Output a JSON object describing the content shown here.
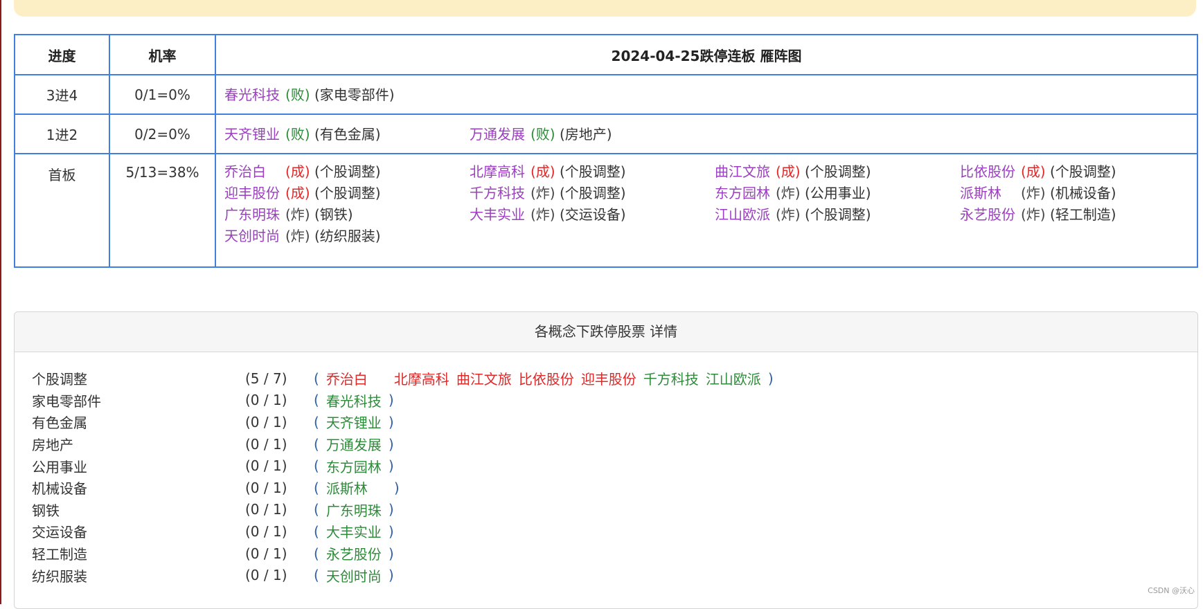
{
  "header": {
    "stage_label": "进度",
    "rate_label": "机率",
    "title": "2024-04-25跌停连板 雁阵图"
  },
  "rows": [
    {
      "stage": "3进4",
      "rate": "0/1=0%",
      "stocks": [
        {
          "name": "春光科技",
          "result": "(败)",
          "result_type": "fail",
          "industry": "(家电零部件)"
        }
      ]
    },
    {
      "stage": "1进2",
      "rate": "0/2=0%",
      "stocks": [
        {
          "name": "天齐锂业",
          "result": "(败)",
          "result_type": "fail",
          "industry": "(有色金属)"
        },
        {
          "name": "万通发展",
          "result": "(败)",
          "result_type": "fail",
          "industry": "(房地产)"
        }
      ]
    },
    {
      "stage": "首板",
      "rate": "5/13=38%",
      "stocks": [
        {
          "name": "乔治白",
          "result": "(成)",
          "result_type": "ok",
          "industry": "(个股调整)"
        },
        {
          "name": "北摩高科",
          "result": "(成)",
          "result_type": "ok",
          "industry": "(个股调整)"
        },
        {
          "name": "曲江文旅",
          "result": "(成)",
          "result_type": "ok",
          "industry": "(个股调整)"
        },
        {
          "name": "比依股份",
          "result": "(成)",
          "result_type": "ok",
          "industry": "(个股调整)"
        },
        {
          "name": "迎丰股份",
          "result": "(成)",
          "result_type": "ok",
          "industry": "(个股调整)"
        },
        {
          "name": "千方科技",
          "result": "(炸)",
          "result_type": "boom",
          "industry": "(个股调整)"
        },
        {
          "name": "东方园林",
          "result": "(炸)",
          "result_type": "boom",
          "industry": "(公用事业)"
        },
        {
          "name": "派斯林",
          "result": "(炸)",
          "result_type": "boom",
          "industry": "(机械设备)"
        },
        {
          "name": "广东明珠",
          "result": "(炸)",
          "result_type": "boom",
          "industry": "(钢铁)"
        },
        {
          "name": "大丰实业",
          "result": "(炸)",
          "result_type": "boom",
          "industry": "(交运设备)"
        },
        {
          "name": "江山欧派",
          "result": "(炸)",
          "result_type": "boom",
          "industry": "(个股调整)"
        },
        {
          "name": "永艺股份",
          "result": "(炸)",
          "result_type": "boom",
          "industry": "(轻工制造)"
        },
        {
          "name": "天创时尚",
          "result": "(炸)",
          "result_type": "boom",
          "industry": "(纺织服装)"
        }
      ]
    }
  ],
  "detail": {
    "title": "各概念下跌停股票 详情",
    "open_paren": "(",
    "close_paren": ")",
    "concepts": [
      {
        "name": "个股调整",
        "count": "(5 / 7)",
        "stocks": [
          {
            "name": "乔治白",
            "color": "red"
          },
          {
            "name": "北摩高科",
            "color": "red"
          },
          {
            "name": "曲江文旅",
            "color": "red"
          },
          {
            "name": "比依股份",
            "color": "red"
          },
          {
            "name": "迎丰股份",
            "color": "red"
          },
          {
            "name": "千方科技",
            "color": "green"
          },
          {
            "name": "江山欧派",
            "color": "green"
          }
        ]
      },
      {
        "name": "家电零部件",
        "count": "(0 / 1)",
        "stocks": [
          {
            "name": "春光科技",
            "color": "green"
          }
        ]
      },
      {
        "name": "有色金属",
        "count": "(0 / 1)",
        "stocks": [
          {
            "name": "天齐锂业",
            "color": "green"
          }
        ]
      },
      {
        "name": "房地产",
        "count": "(0 / 1)",
        "stocks": [
          {
            "name": "万通发展",
            "color": "green"
          }
        ]
      },
      {
        "name": "公用事业",
        "count": "(0 / 1)",
        "stocks": [
          {
            "name": "东方园林",
            "color": "green"
          }
        ]
      },
      {
        "name": "机械设备",
        "count": "(0 / 1)",
        "stocks": [
          {
            "name": "派斯林",
            "color": "green"
          }
        ]
      },
      {
        "name": "钢铁",
        "count": "(0 / 1)",
        "stocks": [
          {
            "name": "广东明珠",
            "color": "green"
          }
        ]
      },
      {
        "name": "交运设备",
        "count": "(0 / 1)",
        "stocks": [
          {
            "name": "大丰实业",
            "color": "green"
          }
        ]
      },
      {
        "name": "轻工制造",
        "count": "(0 / 1)",
        "stocks": [
          {
            "name": "永艺股份",
            "color": "green"
          }
        ]
      },
      {
        "name": "纺织服装",
        "count": "(0 / 1)",
        "stocks": [
          {
            "name": "天创时尚",
            "color": "green"
          }
        ]
      }
    ]
  },
  "colors": {
    "stock_name": "#9b3fc0",
    "result_fail": "#2e8b3a",
    "result_ok": "#e02828",
    "table_border": "#3f7fe0",
    "banner": "#fdefc5"
  },
  "watermark": "CSDN @沃心"
}
